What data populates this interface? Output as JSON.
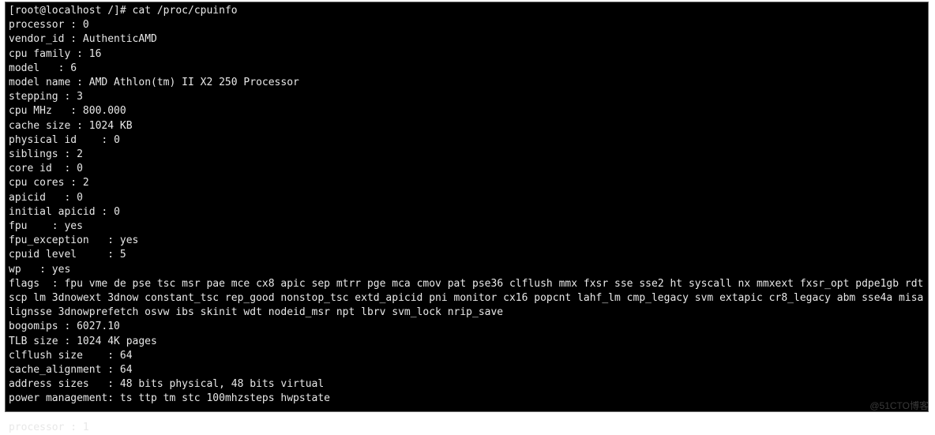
{
  "prompt": "[root@localhost /]# ",
  "command": "cat /proc/cpuinfo",
  "cpuinfo": {
    "processor": "0",
    "vendor_id": "AuthenticAMD",
    "cpu_family": "16",
    "model": "6",
    "model_name": "AMD Athlon(tm) II X2 250 Processor",
    "stepping": "3",
    "cpu_mhz": "800.000",
    "cache_size": "1024 KB",
    "physical_id": "0",
    "siblings": "2",
    "core_id": "0",
    "cpu_cores": "2",
    "apicid": "0",
    "initial_apicid": "0",
    "fpu": "yes",
    "fpu_exception": "yes",
    "cpuid_level": "5",
    "wp": "yes",
    "flags": "fpu vme de pse tsc msr pae mce cx8 apic sep mtrr pge mca cmov pat pse36 clflush mmx fxsr sse sse2 ht syscall nx mmxext fxsr_opt pdpe1gb rdtscp lm 3dnowext 3dnow constant_tsc rep_good nonstop_tsc extd_apicid pni monitor cx16 popcnt lahf_lm cmp_legacy svm extapic cr8_legacy abm sse4a misalignsse 3dnowprefetch osvw ibs skinit wdt nodeid_msr npt lbrv svm_lock nrip_save",
    "bogomips": "6027.10",
    "tlb_size": "1024 4K pages",
    "clflush_size": "64",
    "cache_alignment": "64",
    "address_sizes": "48 bits physical, 48 bits virtual",
    "power_management": "ts ttp tm stc 100mhzsteps hwpstate"
  },
  "next_processor_line": "processor : 1",
  "watermark": "@51CTO博客"
}
